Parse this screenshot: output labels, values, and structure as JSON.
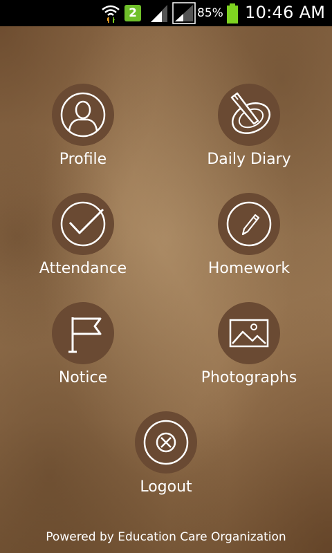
{
  "status_bar": {
    "notification_count": "2",
    "battery_percent": "85%",
    "time": "10:46 AM",
    "icons": [
      "wifi-icon",
      "notification-badge",
      "signal-icon",
      "signal-icon",
      "battery-icon"
    ],
    "battery_color": "#7ed321"
  },
  "menu": {
    "items": [
      {
        "label": "Profile",
        "icon": "user-icon"
      },
      {
        "label": "Daily Diary",
        "icon": "diary-pen-icon"
      },
      {
        "label": "Attendance",
        "icon": "checkmark-icon"
      },
      {
        "label": "Homework",
        "icon": "pencil-icon"
      },
      {
        "label": "Notice",
        "icon": "flag-icon"
      },
      {
        "label": "Photographs",
        "icon": "image-icon"
      },
      {
        "label": "Logout",
        "icon": "close-icon"
      }
    ]
  },
  "footer": {
    "text": "Powered by Education Care Organization"
  },
  "colors": {
    "icon_circle": "#6a4a33",
    "background": "#94714d",
    "text": "#ffffff"
  }
}
